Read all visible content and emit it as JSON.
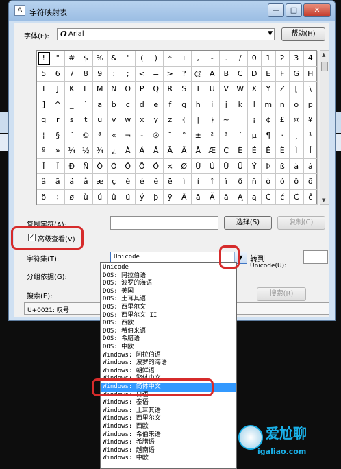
{
  "window": {
    "title": "字符映射表",
    "minimize_label": "—",
    "maximize_label": "□",
    "close_label": "✕"
  },
  "font_row": {
    "label": "字体(F):",
    "font_icon": "O",
    "value": "Arial",
    "help_button": "帮助(H)"
  },
  "grid": {
    "rows": [
      [
        "!",
        "\"",
        "#",
        "$",
        "%",
        "&",
        "'",
        "(",
        ")",
        "*",
        "+",
        ",",
        "-",
        ".",
        "/",
        "0",
        "1",
        "2",
        "3",
        "4"
      ],
      [
        "5",
        "6",
        "7",
        "8",
        "9",
        ":",
        ";",
        "<",
        "=",
        ">",
        "?",
        "@",
        "A",
        "B",
        "C",
        "D",
        "E",
        "F",
        "G",
        "H"
      ],
      [
        "I",
        "J",
        "K",
        "L",
        "M",
        "N",
        "O",
        "P",
        "Q",
        "R",
        "S",
        "T",
        "U",
        "V",
        "W",
        "X",
        "Y",
        "Z",
        "[",
        "\\"
      ],
      [
        "]",
        "^",
        "_",
        "`",
        "a",
        "b",
        "c",
        "d",
        "e",
        "f",
        "g",
        "h",
        "i",
        "j",
        "k",
        "l",
        "m",
        "n",
        "o",
        "p"
      ],
      [
        "q",
        "r",
        "s",
        "t",
        "u",
        "v",
        "w",
        "x",
        "y",
        "z",
        "{",
        "|",
        "}",
        "~",
        "",
        "¡",
        "¢",
        "£",
        "¤",
        "¥"
      ],
      [
        "¦",
        "§",
        "¨",
        "©",
        "ª",
        "«",
        "¬",
        "-",
        "®",
        "¯",
        "°",
        "±",
        "²",
        "³",
        "´",
        "µ",
        "¶",
        "·",
        "¸",
        "¹"
      ],
      [
        "º",
        "»",
        "¼",
        "½",
        "¾",
        "¿",
        "À",
        "Á",
        "Â",
        "Ã",
        "Ä",
        "Å",
        "Æ",
        "Ç",
        "È",
        "É",
        "Ê",
        "Ë",
        "Ì",
        "Í"
      ],
      [
        "Î",
        "Ï",
        "Ð",
        "Ñ",
        "Ò",
        "Ó",
        "Ô",
        "Õ",
        "Ö",
        "×",
        "Ø",
        "Ù",
        "Ú",
        "Û",
        "Ü",
        "Ý",
        "Þ",
        "ß",
        "à",
        "á"
      ],
      [
        "â",
        "ã",
        "ä",
        "å",
        "æ",
        "ç",
        "è",
        "é",
        "ê",
        "ë",
        "ì",
        "í",
        "î",
        "ï",
        "ð",
        "ñ",
        "ò",
        "ó",
        "ô",
        "õ"
      ],
      [
        "ö",
        "÷",
        "ø",
        "ù",
        "ú",
        "û",
        "ü",
        "ý",
        "þ",
        "ÿ",
        "Ā",
        "ā",
        "Ă",
        "ă",
        "Ą",
        "ą",
        "Ć",
        "ć",
        "Ĉ",
        "ĉ"
      ]
    ]
  },
  "copy_row": {
    "label": "复制字符(A):",
    "value": "",
    "select_button": "选择(S)",
    "copy_button": "复制(C)"
  },
  "advanced": {
    "label": "高级查看(V)",
    "checked": true,
    "check_glyph": "✓"
  },
  "charset_row": {
    "label": "字符集(T):",
    "value": "Unicode",
    "goto_label": "转到",
    "goto_sublabel": "Unicode(U):",
    "goto_value": ""
  },
  "group_row": {
    "label": "分组依据(G):"
  },
  "search_row": {
    "label": "搜索(E):",
    "button": "搜索(R)"
  },
  "status": {
    "text": "U+0021: 叹号"
  },
  "dropdown": {
    "options": [
      "Unicode",
      "DOS: 阿拉伯语",
      "DOS: 波罗的海语",
      "DOS: 美国",
      "DOS: 土耳其语",
      "DOS: 西里尔文",
      "DOS: 西里尔文 II",
      "DOS: 西欧",
      "DOS: 希伯来语",
      "DOS: 希腊语",
      "DOS: 中欧",
      "Windows: 阿拉伯语",
      "Windows: 波罗的海语",
      "Windows: 朝鲜语",
      "Windows: 繁体中文",
      "Windows: 简体中文",
      "Windows: 日语",
      "Windows: 泰语",
      "Windows: 土耳其语",
      "Windows: 西里尔文",
      "Windows: 西欧",
      "Windows: 希伯来语",
      "Windows: 希腊语",
      "Windows: 越南语",
      "Windows: 中欧"
    ],
    "highlighted_index": 15
  },
  "watermark": {
    "text": "爱尬聊",
    "url": "igaliao.com"
  },
  "colors": {
    "annotation": "#d62b2b",
    "highlight": "#3399ff"
  }
}
